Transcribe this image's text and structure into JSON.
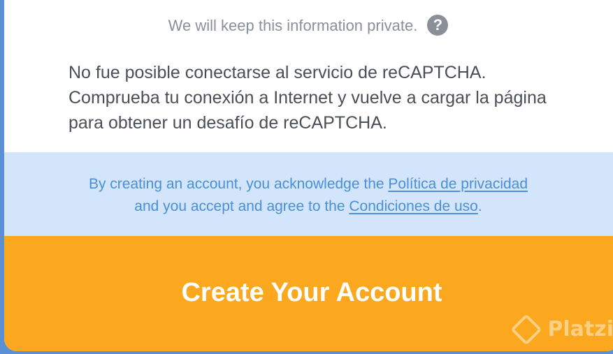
{
  "privacy": {
    "text": "We will keep this information private.",
    "help_icon": "?"
  },
  "recaptcha": {
    "error_message": "No fue posible conectarse al servicio de reCAPTCHA. Comprueba tu conexión a Internet y vuelve a cargar la página para obtener un desafío de reCAPTCHA."
  },
  "terms": {
    "prefix": "By creating an account, you acknowledge the ",
    "privacy_link": "Política de privacidad",
    "middle": " and you accept and agree to the ",
    "terms_link": "Condiciones de uso",
    "suffix": "."
  },
  "actions": {
    "create_account": "Create Your Account"
  },
  "watermark": {
    "text": "Platzi"
  },
  "colors": {
    "button_bg": "#fba81e",
    "terms_band_bg": "#d3e5fa",
    "link": "#4a8fd8",
    "body_text": "#4a4f57",
    "muted_text": "#8a8f99"
  }
}
